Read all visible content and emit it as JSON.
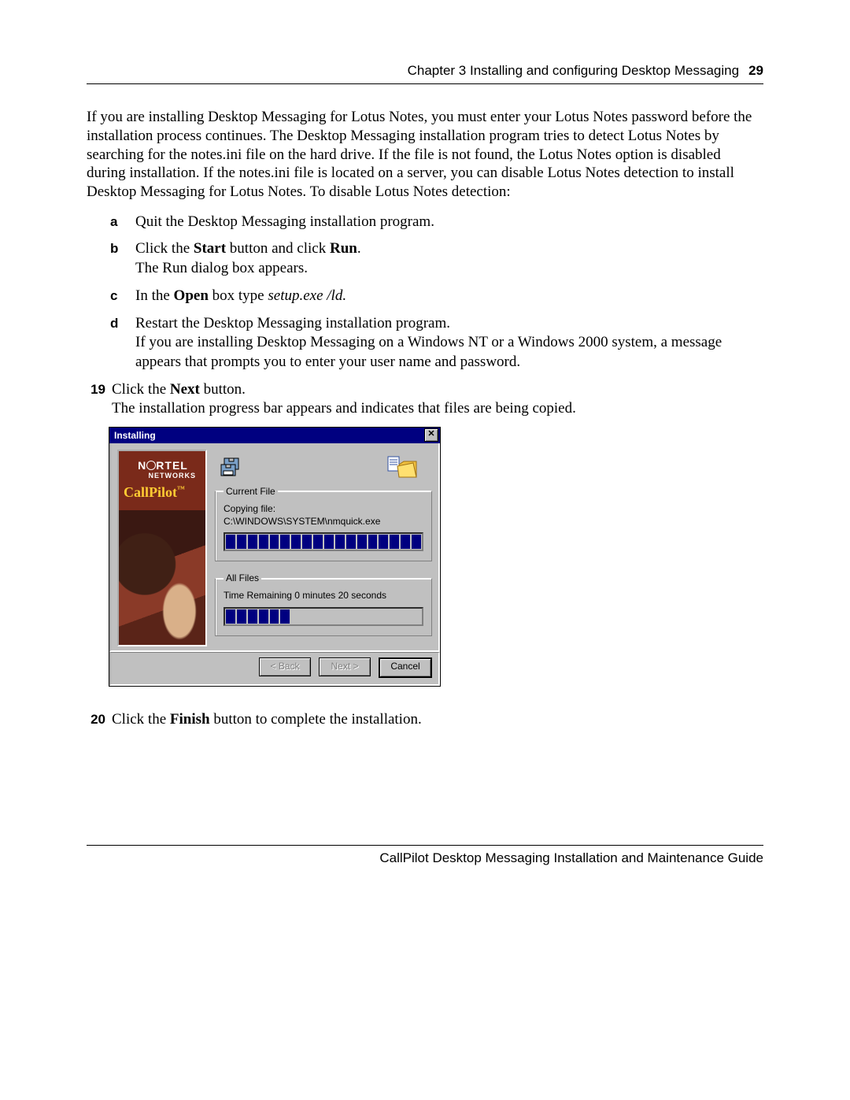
{
  "header": {
    "chapter": "Chapter 3  Installing and configuring Desktop Messaging",
    "page_number": "29"
  },
  "intro_paragraph": "If you are installing Desktop Messaging for Lotus Notes, you must enter your Lotus Notes password before the installation process continues. The Desktop Messaging installation program tries to detect Lotus Notes by searching for the notes.ini file on the hard drive. If the file is not found, the Lotus Notes option is disabled during installation. If the notes.ini file is located on a server, you can disable Lotus Notes detection to install Desktop Messaging for Lotus Notes. To disable Lotus Notes detection:",
  "sub_steps": {
    "a": {
      "marker": "a",
      "text": "Quit the Desktop Messaging installation program."
    },
    "b": {
      "marker": "b",
      "line1_pre": "Click the ",
      "bold1": "Start",
      "mid": " button and click ",
      "bold2": "Run",
      "post": ".",
      "line2": "The Run dialog box appears."
    },
    "c": {
      "marker": "c",
      "pre": "In the ",
      "bold": "Open",
      "mid": " box type ",
      "italic": "setup.exe /ld."
    },
    "d": {
      "marker": "d",
      "line1": "Restart the Desktop Messaging installation program.",
      "line2": "If you are installing Desktop Messaging on a Windows NT or a Windows 2000 system, a message appears that prompts you to enter your user name and password."
    }
  },
  "steps": {
    "s19": {
      "marker": "19",
      "line1_pre": "Click the ",
      "bold": "Next",
      "line1_post": " button.",
      "line2": "The installation progress bar appears and indicates that files are being copied."
    },
    "s20": {
      "marker": "20",
      "pre": "Click the ",
      "bold": "Finish",
      "post": " button to complete the installation."
    }
  },
  "installer": {
    "title": "Installing",
    "close_glyph": "✕",
    "brand_line1a": "N",
    "brand_line1b": "RTEL",
    "brand_line2": "NETWORKS",
    "product": "CallPilot",
    "tm": "™",
    "current_file_legend": "Current File",
    "copying_label": "Copying file:",
    "copying_path": "C:\\WINDOWS\\SYSTEM\\nmquick.exe",
    "all_files_legend": "All Files",
    "time_remaining": "Time Remaining 0 minutes 20 seconds",
    "buttons": {
      "back": "< Back",
      "next": "Next >",
      "cancel": "Cancel"
    },
    "progress1_segments": 18,
    "progress1_filled": 18,
    "progress2_segments": 18,
    "progress2_filled": 6
  },
  "footer": "CallPilot Desktop Messaging Installation and Maintenance Guide"
}
